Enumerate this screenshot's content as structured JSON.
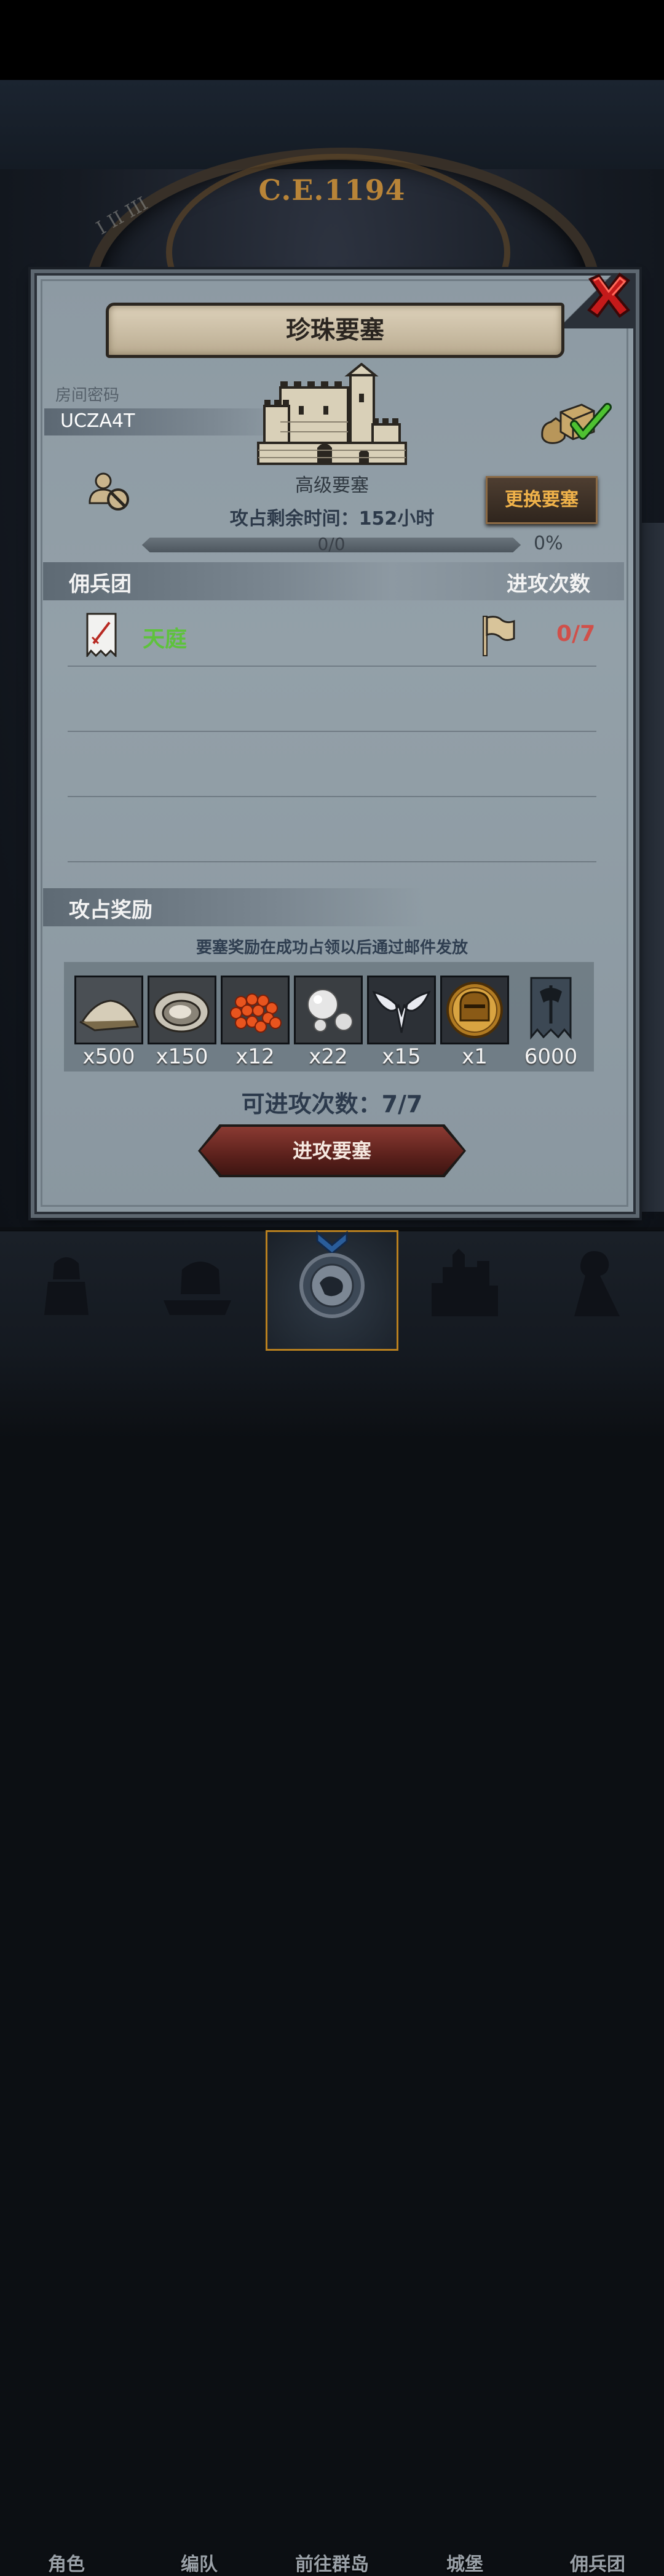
{
  "background": {
    "era": "C.E.1194"
  },
  "dialog": {
    "title": "珍珠要塞",
    "room_code_label": "房间密码",
    "room_code": "UCZA4T",
    "fortress_grade": "高级要塞",
    "remaining_time": "攻占剩余时间：152小时",
    "change_button": "更换要塞",
    "progress_text": "0/0",
    "progress_percent": "0%",
    "progress_value": 0,
    "merc_header": "佣兵团",
    "attack_count_header": "进攻次数",
    "mercenaries": [
      {
        "name": "天庭",
        "attacks": "0/7"
      }
    ],
    "reward_header": "攻占奖励",
    "reward_note": "要塞奖励在成功占领以后通过邮件发放",
    "rewards": [
      {
        "icon": "flour-pile-icon",
        "qty": "x500"
      },
      {
        "icon": "oyster-icon",
        "qty": "x150"
      },
      {
        "icon": "fish-roe-icon",
        "qty": "x12"
      },
      {
        "icon": "pearls-icon",
        "qty": "x22"
      },
      {
        "icon": "winged-emblem-icon",
        "qty": "x15"
      },
      {
        "icon": "knight-helmet-medal-icon",
        "qty": "x1"
      },
      {
        "icon": "guild-banner-icon",
        "qty": "6000"
      }
    ],
    "attacks_left": "可进攻次数：7/7",
    "attack_button": "进攻要塞"
  },
  "nav": {
    "items": [
      {
        "label": "角色",
        "icon": "knight-icon"
      },
      {
        "label": "编队",
        "icon": "helmet-icon"
      },
      {
        "label": "前往群岛",
        "icon": "islands-compass-icon",
        "active": true
      },
      {
        "label": "城堡",
        "icon": "castle-icon"
      },
      {
        "label": "佣兵团",
        "icon": "mercenary-icon"
      }
    ]
  },
  "colors": {
    "merc_name": "#5ec23c",
    "attack_count": "#d0504a",
    "change_button_text": "#f0b24a",
    "active_nav_border": "#b9801f"
  }
}
